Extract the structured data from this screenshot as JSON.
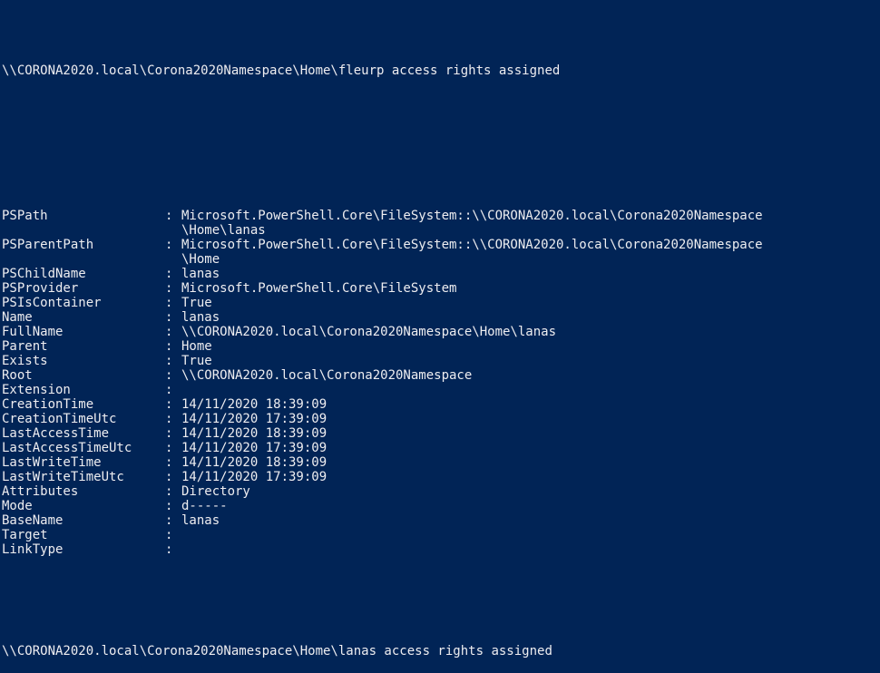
{
  "console": {
    "background": "#012456",
    "foreground": "#eeedf0",
    "header_line": "\\\\CORONA2020.local\\Corona2020Namespace\\Home\\fleurp access rights assigned",
    "footer_line": "\\\\CORONA2020.local\\Corona2020Namespace\\Home\\lanas access rights assigned",
    "separator": ":",
    "properties": [
      {
        "name": "PSPath",
        "value": "Microsoft.PowerShell.Core\\FileSystem::\\\\CORONA2020.local\\Corona2020Namespace",
        "cont": "\\Home\\lanas"
      },
      {
        "name": "PSParentPath",
        "value": "Microsoft.PowerShell.Core\\FileSystem::\\\\CORONA2020.local\\Corona2020Namespace",
        "cont": "\\Home"
      },
      {
        "name": "PSChildName",
        "value": "lanas"
      },
      {
        "name": "PSProvider",
        "value": "Microsoft.PowerShell.Core\\FileSystem"
      },
      {
        "name": "PSIsContainer",
        "value": "True"
      },
      {
        "name": "Name",
        "value": "lanas"
      },
      {
        "name": "FullName",
        "value": "\\\\CORONA2020.local\\Corona2020Namespace\\Home\\lanas"
      },
      {
        "name": "Parent",
        "value": "Home"
      },
      {
        "name": "Exists",
        "value": "True"
      },
      {
        "name": "Root",
        "value": "\\\\CORONA2020.local\\Corona2020Namespace"
      },
      {
        "name": "Extension",
        "value": ""
      },
      {
        "name": "CreationTime",
        "value": "14/11/2020 18:39:09"
      },
      {
        "name": "CreationTimeUtc",
        "value": "14/11/2020 17:39:09"
      },
      {
        "name": "LastAccessTime",
        "value": "14/11/2020 18:39:09"
      },
      {
        "name": "LastAccessTimeUtc",
        "value": "14/11/2020 17:39:09"
      },
      {
        "name": "LastWriteTime",
        "value": "14/11/2020 18:39:09"
      },
      {
        "name": "LastWriteTimeUtc",
        "value": "14/11/2020 17:39:09"
      },
      {
        "name": "Attributes",
        "value": "Directory"
      },
      {
        "name": "Mode",
        "value": "d-----"
      },
      {
        "name": "BaseName",
        "value": "lanas"
      },
      {
        "name": "Target",
        "value": ""
      },
      {
        "name": "LinkType",
        "value": ""
      }
    ]
  }
}
